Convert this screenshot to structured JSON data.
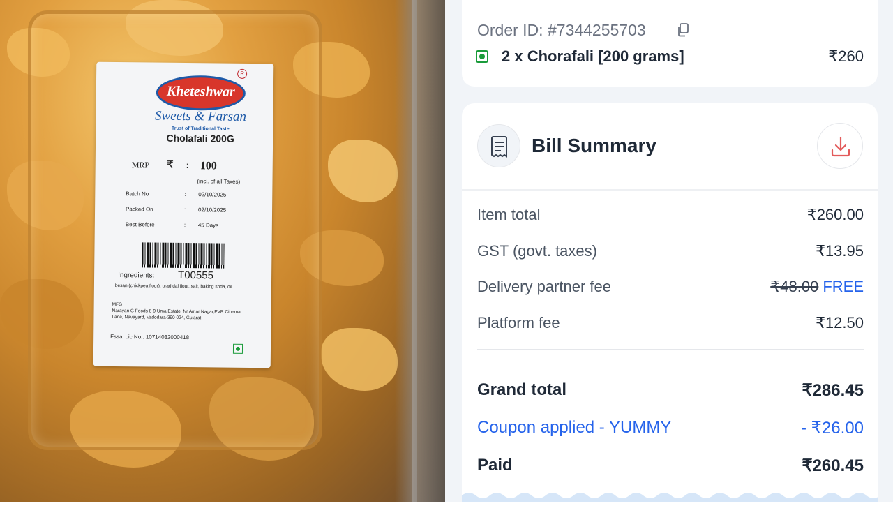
{
  "product_label": {
    "brand": "Kheteshwar",
    "registered_mark": "R",
    "sub_brand": "Sweets & Farsan",
    "tagline": "Trust of Traditional Taste",
    "product_name": "Cholafali 200G",
    "mrp_label": "MRP",
    "rupee_symbol": "₹",
    "colon": ":",
    "mrp_value": "100",
    "mrp_note": "(incl. of all Taxes)",
    "details": [
      {
        "key": "Batch No",
        "value": "02/10/2025"
      },
      {
        "key": "Packed On",
        "value": "02/10/2025"
      },
      {
        "key": "Best Before",
        "value": "45 Days"
      }
    ],
    "ingredients_label": "Ingredients:",
    "code": "T00555",
    "ingredients_text": "besan (chickpea flour), urad dal flour, salt, baking soda, oil.",
    "mfg_label": "MFG",
    "mfg_text": "Narayan G Foods 8-9 Uma Estate, Nr Amar Nagar,PVR Cinema Lane, Navayard, Vadodara-390 024, Gujarat",
    "fssai": "Fssai Lic No.: 10714032000418"
  },
  "order": {
    "order_id": "Order ID: #7344255703",
    "item": "2 x Chorafali [200 grams]",
    "item_price": "₹260"
  },
  "bill": {
    "title": "Bill Summary",
    "lines": [
      {
        "label": "Item total",
        "value": "₹260.00"
      },
      {
        "label": "GST (govt. taxes)",
        "value": "₹13.95"
      },
      {
        "label": "Delivery partner fee",
        "value_strike": "₹48.00",
        "value_free": "FREE"
      },
      {
        "label": "Platform fee",
        "value": "₹12.50"
      }
    ],
    "grand_total_label": "Grand total",
    "grand_total_value": "₹286.45",
    "coupon_label": "Coupon applied - YUMMY",
    "coupon_value": "- ₹26.00",
    "paid_label": "Paid",
    "paid_value": "₹260.45"
  },
  "colors": {
    "accent_blue": "#2563eb",
    "veg_green": "#1a9b3a",
    "download_red": "#e35b5b"
  }
}
